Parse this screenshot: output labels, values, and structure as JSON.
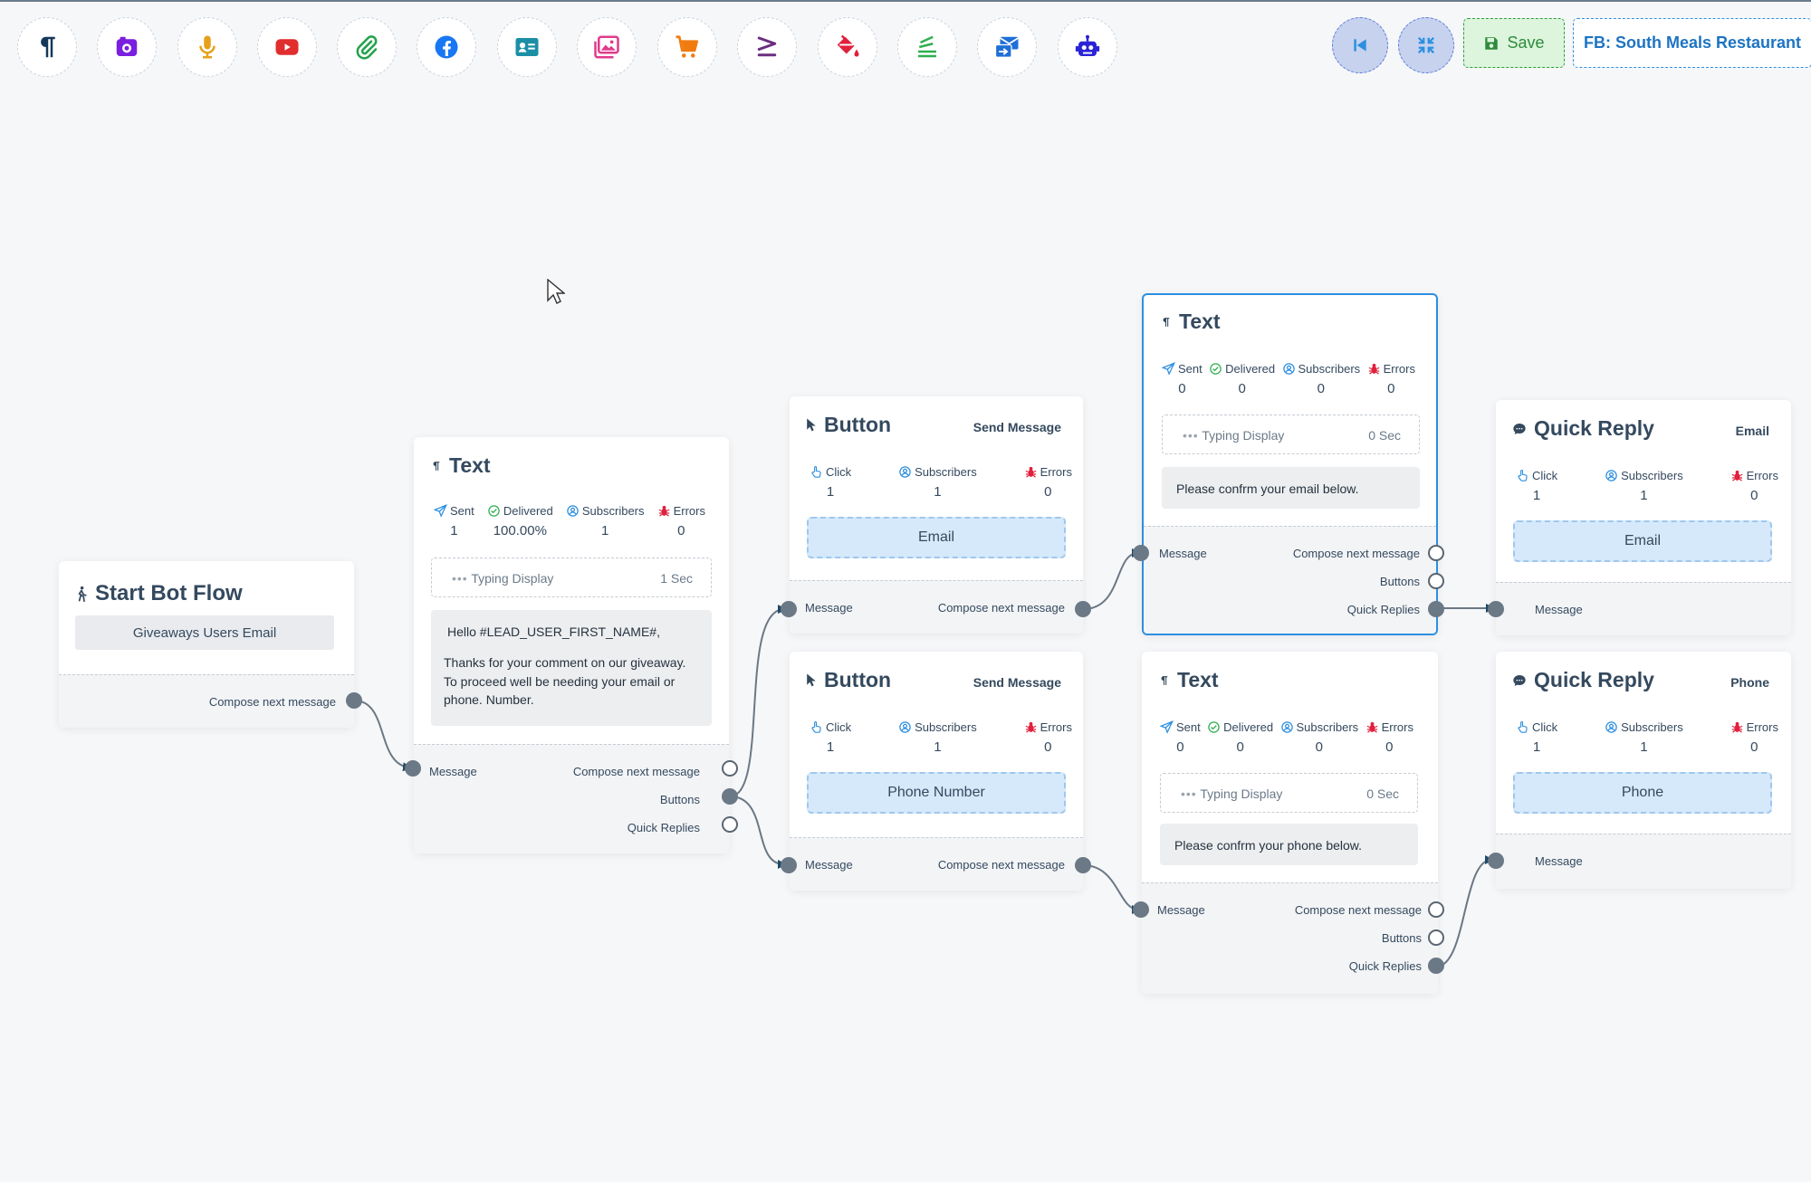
{
  "toolbar": {
    "icons": [
      "text-icon",
      "card-icon",
      "microphone-icon",
      "youtube-icon",
      "attachment-icon",
      "facebook-icon",
      "contact-card-icon",
      "gallery-icon",
      "cart-icon",
      "greater-equal-icon",
      "paint-bucket-icon",
      "stack-icon",
      "mail-forward-icon",
      "robot-icon"
    ],
    "save_label": "Save",
    "page_label": "FB: South Meals Restaurant"
  },
  "nodes": {
    "start": {
      "title": "Start Bot Flow",
      "button": "Giveaways Users Email",
      "out": "Compose next message"
    },
    "text1": {
      "title": "Text",
      "stats": {
        "sent_label": "Sent",
        "sent": "1",
        "delivered_label": "Delivered",
        "delivered": "100.00%",
        "subs_label": "Subscribers",
        "subs": "1",
        "errors_label": "Errors",
        "errors": "0"
      },
      "typing_label": "Typing Display",
      "typing_time": "1 Sec",
      "message_line1": "Hello  #LEAD_USER_FIRST_NAME#,",
      "message_line2": "Thanks for your comment on our giveaway. To proceed well be needing your email or phone. Number.",
      "in": "Message",
      "out_compose": "Compose next message",
      "out_buttons": "Buttons",
      "out_quick": "Quick Replies"
    },
    "button1": {
      "title": "Button",
      "subtitle": "Send Message",
      "stats": {
        "click_label": "Click",
        "click": "1",
        "subs_label": "Subscribers",
        "subs": "1",
        "errors_label": "Errors",
        "errors": "0"
      },
      "button": "Email",
      "in": "Message",
      "out": "Compose next message"
    },
    "button2": {
      "title": "Button",
      "subtitle": "Send Message",
      "stats": {
        "click_label": "Click",
        "click": "1",
        "subs_label": "Subscribers",
        "subs": "1",
        "errors_label": "Errors",
        "errors": "0"
      },
      "button": "Phone Number",
      "in": "Message",
      "out": "Compose next message"
    },
    "text2": {
      "title": "Text",
      "stats": {
        "sent_label": "Sent",
        "sent": "0",
        "delivered_label": "Delivered",
        "delivered": "0",
        "subs_label": "Subscribers",
        "subs": "0",
        "errors_label": "Errors",
        "errors": "0"
      },
      "typing_label": "Typing Display",
      "typing_time": "0 Sec",
      "message": "Please confrm your email below.",
      "in": "Message",
      "out_compose": "Compose next message",
      "out_buttons": "Buttons",
      "out_quick": "Quick Replies"
    },
    "text3": {
      "title": "Text",
      "stats": {
        "sent_label": "Sent",
        "sent": "0",
        "delivered_label": "Delivered",
        "delivered": "0",
        "subs_label": "Subscribers",
        "subs": "0",
        "errors_label": "Errors",
        "errors": "0"
      },
      "typing_label": "Typing Display",
      "typing_time": "0 Sec",
      "message": "Please confrm your phone below.",
      "in": "Message",
      "out_compose": "Compose next message",
      "out_buttons": "Buttons",
      "out_quick": "Quick Replies"
    },
    "qr1": {
      "title": "Quick Reply",
      "subtitle": "Email",
      "stats": {
        "click_label": "Click",
        "click": "1",
        "subs_label": "Subscribers",
        "subs": "1",
        "errors_label": "Errors",
        "errors": "0"
      },
      "button": "Email",
      "in": "Message"
    },
    "qr2": {
      "title": "Quick Reply",
      "subtitle": "Phone",
      "stats": {
        "click_label": "Click",
        "click": "1",
        "subs_label": "Subscribers",
        "subs": "1",
        "errors_label": "Errors",
        "errors": "0"
      },
      "button": "Phone",
      "in": "Message"
    }
  },
  "colors": {
    "accent": "#2c8fe0",
    "wire": "#6b7885",
    "save": "#2e8b3c",
    "button_fill": "#d5e9fb"
  }
}
